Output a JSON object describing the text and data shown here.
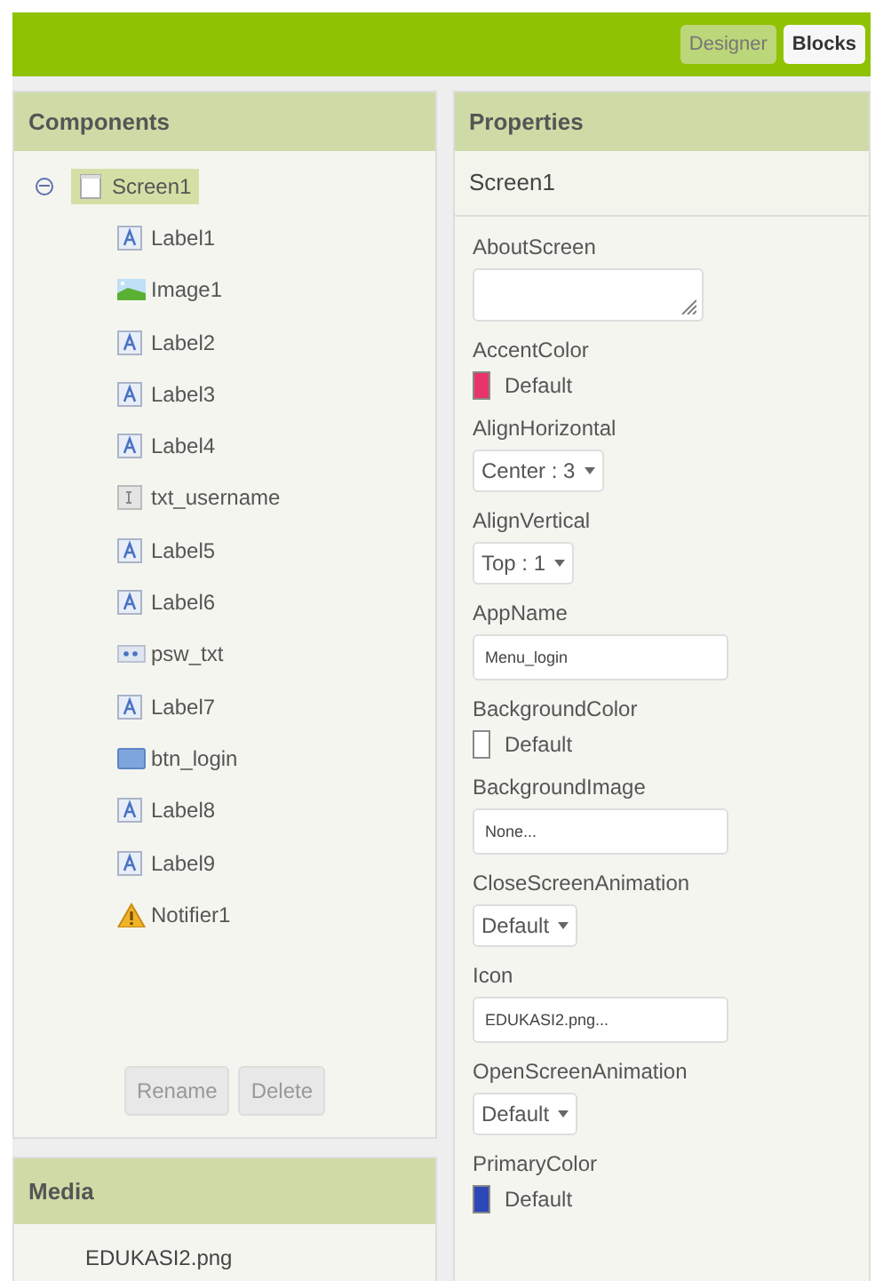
{
  "toolbar": {
    "buttons": [
      {
        "label": "Designer",
        "selected": false
      },
      {
        "label": "Blocks",
        "selected": true
      }
    ]
  },
  "components": {
    "title": "Components",
    "tree": [
      {
        "label": "Screen1",
        "kind": "screen",
        "expanded": true,
        "selected": true,
        "children": [
          {
            "label": "Label1",
            "kind": "label"
          },
          {
            "label": "Image1",
            "kind": "image"
          },
          {
            "label": "Label2",
            "kind": "label"
          },
          {
            "label": "Label3",
            "kind": "label"
          },
          {
            "label": "Label4",
            "kind": "label"
          },
          {
            "label": "txt_username",
            "kind": "textbox"
          },
          {
            "label": "Label5",
            "kind": "label"
          },
          {
            "label": "Label6",
            "kind": "label"
          },
          {
            "label": "psw_txt",
            "kind": "password"
          },
          {
            "label": "Label7",
            "kind": "label"
          },
          {
            "label": "btn_login",
            "kind": "button"
          },
          {
            "label": "Label8",
            "kind": "label"
          },
          {
            "label": "Label9",
            "kind": "label"
          },
          {
            "label": "Notifier1",
            "kind": "notifier"
          }
        ]
      }
    ],
    "buttons": [
      "Rename",
      "Delete"
    ]
  },
  "media": {
    "title": "Media",
    "files": [
      "EDUKASI2.png"
    ]
  },
  "properties": {
    "title": "Properties",
    "component": "Screen1",
    "items": [
      {
        "name": "AboutScreen",
        "kind": "textarea"
      },
      {
        "name": "AccentColor",
        "kind": "color",
        "value": "Default",
        "color": "#e8336b"
      },
      {
        "name": "AlignHorizontal",
        "kind": "dropdown",
        "value": "Center : 3"
      },
      {
        "name": "AlignVertical",
        "kind": "dropdown",
        "value": "Top : 1"
      },
      {
        "name": "AppName",
        "kind": "text",
        "value": "Menu_login"
      },
      {
        "name": "BackgroundColor",
        "kind": "color",
        "value": "Default",
        "color": "#ffffff"
      },
      {
        "name": "BackgroundImage",
        "kind": "text",
        "value": "None..."
      },
      {
        "name": "CloseScreenAnimation",
        "kind": "dropdown",
        "value": "Default"
      },
      {
        "name": "Icon",
        "kind": "text",
        "value": "EDUKASI2.png..."
      },
      {
        "name": "OpenScreenAnimation",
        "kind": "dropdown",
        "value": "Default"
      },
      {
        "name": "PrimaryColor",
        "kind": "color",
        "value": "Default",
        "color": "#2e47b8"
      }
    ]
  }
}
